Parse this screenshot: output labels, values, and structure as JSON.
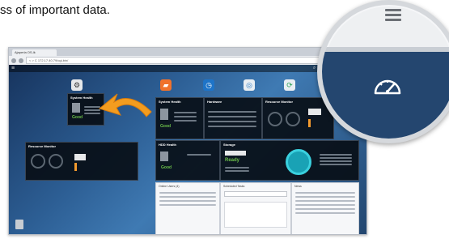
{
  "caption": "ss of important data.",
  "browser": {
    "tab_title": "Ajaperla OS-lk",
    "url": "< > C 172.17.40.79/cgi-bin/"
  },
  "panels": {
    "system_health_small": {
      "title": "System Health",
      "status": "Good"
    },
    "system_health_main": {
      "title": "System Health",
      "status": "Good"
    },
    "hardware": {
      "title": "Hardware"
    },
    "resource_monitor": {
      "title": "Resource Monitor"
    },
    "resource_monitor_small": {
      "title": "Resource Monitor"
    },
    "hdd_health": {
      "title": "HDD Health",
      "status": "Good"
    },
    "storage": {
      "title": "Storage",
      "state": "Ready"
    },
    "online_users": {
      "title": "Online Users (4)"
    },
    "scheduled_tasks": {
      "title": "Scheduled Tasks"
    },
    "news": {
      "title": "News"
    }
  },
  "colors": {
    "desktop_accent": "#2d5f95",
    "good": "#6cc04a",
    "arrow": "#f39c1f",
    "storage_ring": "#19a2b5"
  },
  "icons": {
    "lens_icon": "dashboard-gauge-icon",
    "lens_menu": "hamburger-menu-icon"
  }
}
